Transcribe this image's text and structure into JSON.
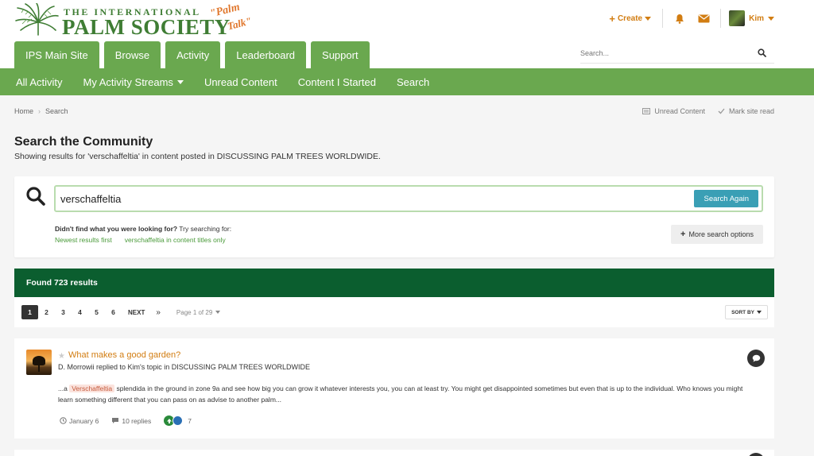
{
  "brand": {
    "line1": "THE INTERNATIONAL",
    "line2": "PALM SOCIETY",
    "script1": "\"Palm",
    "script2": "Talk\""
  },
  "userbar": {
    "create_label": "Create",
    "user_name": "Kim"
  },
  "tabs": [
    {
      "label": "IPS Main Site"
    },
    {
      "label": "Browse"
    },
    {
      "label": "Activity"
    },
    {
      "label": "Leaderboard"
    },
    {
      "label": "Support"
    }
  ],
  "header_search": {
    "placeholder": "Search..."
  },
  "subnav": [
    {
      "label": "All Activity"
    },
    {
      "label": "My Activity Streams"
    },
    {
      "label": "Unread Content"
    },
    {
      "label": "Content I Started"
    },
    {
      "label": "Search"
    }
  ],
  "breadcrumb": {
    "home": "Home",
    "current": "Search"
  },
  "crumb_actions": {
    "unread": "Unread Content",
    "mark_read": "Mark site read"
  },
  "page": {
    "title": "Search the Community",
    "description": "Showing results for 'verschaffeltia' in content posted in DISCUSSING PALM TREES WORLDWIDE."
  },
  "search": {
    "value": "verschaffeltia",
    "button": "Search Again",
    "didnt_find_bold": "Didn't find what you were looking for?",
    "didnt_find_rest": " Try searching for:",
    "suggest1": "Newest results first",
    "suggest2": "verschaffeltia in content titles only",
    "more_options": "More search options"
  },
  "results": {
    "found_label": "Found 723 results"
  },
  "pagination": {
    "pages": [
      "1",
      "2",
      "3",
      "4",
      "5",
      "6"
    ],
    "current": "1",
    "next": "NEXT",
    "last": "»",
    "page_of": "Page 1 of 29",
    "sort_by": "SORT BY"
  },
  "result_item": {
    "title": "What makes a good garden?",
    "meta": "D. Morrowii replied to Kim's topic in DISCUSSING PALM TREES WORLDWIDE",
    "snippet_pre": "...a ",
    "snippet_highlight": "Verschaffeltia",
    "snippet_post": " splendida in the ground in zone 9a and see how big you can grow it whatever interests you, you can at least try. You might get disappointed sometimes but even that is up to the individual. Who knows you might learn something different that you can pass on as advise to another palm...",
    "date": "January 6",
    "replies": "10 replies",
    "reactions": "7"
  },
  "colors": {
    "green": "#6aa84f",
    "dark_green": "#0b5e2f",
    "orange": "#d27d12",
    "teal": "#3a9fb5"
  }
}
